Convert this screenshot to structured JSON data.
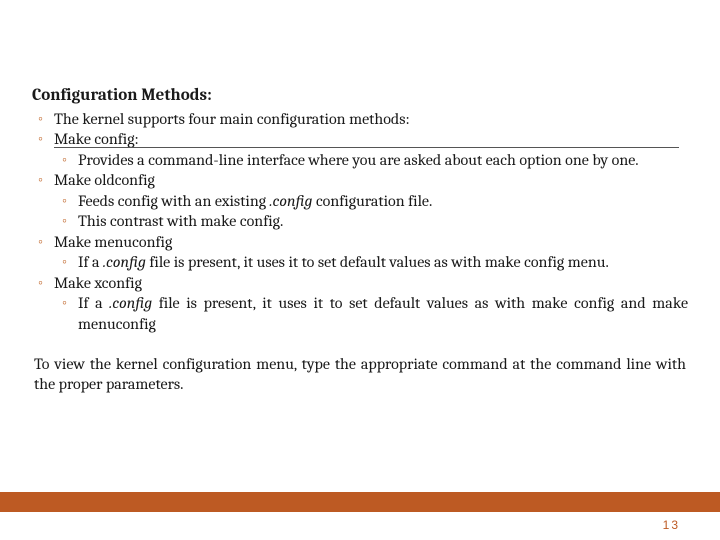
{
  "heading": "Configuration Methods:",
  "b1": "The kernel supports four main configuration methods:",
  "b2": "Make config:",
  "b2a": "Provides a command-line interface where you are asked about each option one by one.",
  "b3": "Make oldconfig",
  "b3a_pre": "Feeds config with an existing ",
  "b3a_it": ".config",
  "b3a_post": " configuration file.",
  "b3b": "This contrast with make config.",
  "b4": "Make menuconfig",
  "b4a_pre": "If a ",
  "b4a_it": ".config",
  "b4a_post": " file is present, it uses it to set default values as with make config menu.",
  "b5": "Make xconfig",
  "b5a_pre": "If a ",
  "b5a_it": ".config",
  "b5a_post": " file is present, it uses it to set default values as with make config and make menuconfig",
  "para": "To view the kernel configuration menu, type the appropriate command at the command line with the proper parameters.",
  "page": "13"
}
